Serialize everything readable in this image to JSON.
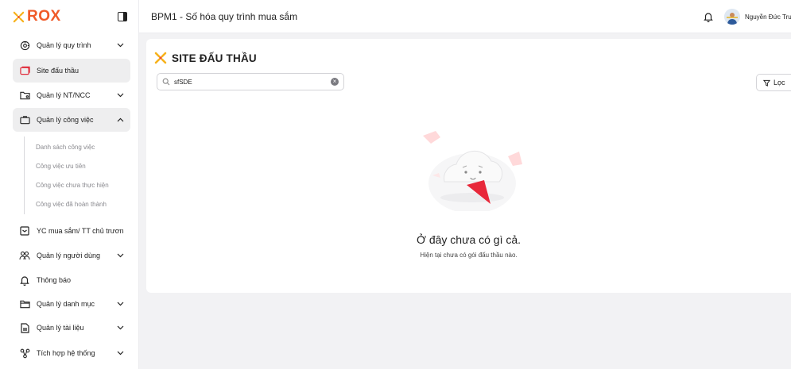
{
  "brand": {
    "logo_text": "ROX",
    "accent": "#f05a28"
  },
  "header": {
    "title": "BPM1 - Số hóa quy trình mua sắm",
    "user_name": "Nguyễn Đức Trun"
  },
  "sidebar": {
    "items": [
      {
        "label": "Quản lý quy trình",
        "icon": "process-icon",
        "has_chevron": true
      },
      {
        "label": "Site đấu thầu",
        "icon": "site-icon",
        "active": true
      },
      {
        "label": "Quản lý NT/NCC",
        "icon": "folder-user-icon",
        "has_chevron": true
      },
      {
        "label": "Quản lý công việc",
        "icon": "briefcase-icon",
        "expanded": true
      },
      {
        "label": "YC mua sắm/ TT chủ trương",
        "icon": "tray-icon"
      },
      {
        "label": "Quản lý người dùng",
        "icon": "users-icon",
        "has_chevron": true
      },
      {
        "label": "Thông báo",
        "icon": "bell-icon"
      },
      {
        "label": "Quản lý danh mục",
        "icon": "folder-icon",
        "has_chevron": true
      },
      {
        "label": "Quản lý tài liệu",
        "icon": "document-icon",
        "has_chevron": true
      },
      {
        "label": "Tích hợp hệ thống",
        "icon": "integration-icon",
        "has_chevron": true
      }
    ],
    "sub_items": [
      "Danh sách công việc",
      "Công việc ưu tiên",
      "Công việc chưa thực hiện",
      "Công việc đã hoàn thành"
    ]
  },
  "main": {
    "title": "SITE ĐẤU THẦU",
    "search_value": "sfSDE",
    "filter_label": "Lọc",
    "empty_title": "Ở đây chưa có gì cả.",
    "empty_subtitle": "Hiện tại chưa có gói đấu thầu nào."
  }
}
